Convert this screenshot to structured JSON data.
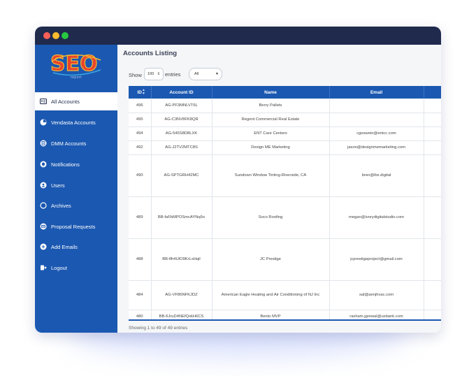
{
  "brand": {
    "logo_text": "SEO",
    "logo_sub": "report"
  },
  "sidebar": {
    "items": [
      {
        "label": "All Accounts",
        "icon": "id-card-icon",
        "active": true
      },
      {
        "label": "Vendasta Accounts",
        "icon": "pie-chart-icon",
        "active": false
      },
      {
        "label": "DMM Accounts",
        "icon": "document-icon",
        "active": false
      },
      {
        "label": "Notifications",
        "icon": "bell-icon",
        "active": false
      },
      {
        "label": "Users",
        "icon": "user-icon",
        "active": false
      },
      {
        "label": "Archives",
        "icon": "circle-icon",
        "active": false
      },
      {
        "label": "Proposal Requests",
        "icon": "card-icon",
        "active": false
      },
      {
        "label": "Add Emails",
        "icon": "plus-icon",
        "active": false
      },
      {
        "label": "Logout",
        "icon": "logout-icon",
        "active": false
      }
    ]
  },
  "main": {
    "title": "Accounts Listing",
    "show_label": "Show",
    "page_size": "100",
    "entries_label": "entries",
    "filter_value": "All",
    "info": "Showing 1 to 49 of 49 entries"
  },
  "table": {
    "headers": [
      "ID",
      "Account ID",
      "Name",
      "Email",
      ""
    ],
    "rows": [
      [
        "496",
        "AG-PF3MNLVT6L",
        "Berry Pallets",
        ""
      ],
      [
        "495",
        "AG-C3NV8FK8QR",
        "Regent Commercial Real Estate",
        ""
      ],
      [
        "494",
        "AG-545S8D8LXK",
        "ENT Care Centers",
        "cgeswein@entcc.com"
      ],
      [
        "492",
        "AG-J2TV2MTC8S",
        "Design ME Marketing",
        "jason@designmemarketing.com"
      ],
      [
        "490",
        "AG-SPTGRH42MC",
        "Sundown Window Tinting-Riverside, CA",
        "bren@lbx.digital"
      ],
      [
        "489",
        "BB-faFbMPOSmcAYNq5o",
        "Soco Roofing",
        "megan@ivorydigitalstudio.com"
      ],
      [
        "488",
        "BB-tfh4UlO9KrLxHqil",
        "JC Prestige",
        "jcprestigeproject@gmail.com"
      ],
      [
        "484",
        "AG-VF86NFKJDZ",
        "American Eagle Heating and Air Conditioning of NJ Inc",
        "sal@aenjhvac.com"
      ],
      [
        "480",
        "BB-6JruD4NEfQxkH6CS",
        "Bento MVP",
        "rasham.jgrewal@usbank.com"
      ]
    ]
  },
  "colors": {
    "primary": "#1b58b1",
    "titlebar": "#1f2a4d",
    "background": "#f5f6f8"
  }
}
